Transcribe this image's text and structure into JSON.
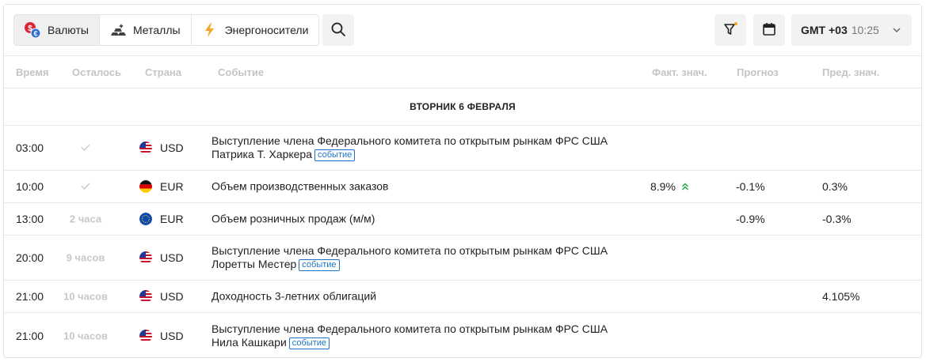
{
  "tabs": [
    {
      "label": "Валюты",
      "icon": "currency-icon",
      "active": true
    },
    {
      "label": "Металлы",
      "icon": "metal-bars-icon",
      "active": false
    },
    {
      "label": "Энергоносители",
      "icon": "lightning-icon",
      "active": false
    }
  ],
  "timezone": {
    "gmt": "GMT +03",
    "time": "10:25"
  },
  "columns": {
    "time": "Время",
    "left": "Осталось",
    "country": "Страна",
    "event": "Событие",
    "actual": "Факт. знач.",
    "forecast": "Прогноз",
    "previous": "Пред. знач."
  },
  "day_header": "ВТОРНИК 6 ФЕВРАЛЯ",
  "badge_label": "событие",
  "accent_colors": {
    "badge": "#1e73c8",
    "up_arrow": "#27a844",
    "filter_dot": "#f5a623"
  },
  "rows": [
    {
      "time": "03:00",
      "left": "",
      "done": true,
      "flag": "us",
      "currency": "USD",
      "event": "Выступление члена Федерального комитета по открытым рынкам ФРС США Патрика Т. Харкера",
      "badge": true,
      "actual": "",
      "forecast": "",
      "previous": ""
    },
    {
      "time": "10:00",
      "left": "",
      "done": true,
      "flag": "de",
      "currency": "EUR",
      "event": "Объем производственных заказов",
      "badge": false,
      "actual": "8.9%",
      "trend": "up",
      "forecast": "-0.1%",
      "previous": "0.3%"
    },
    {
      "time": "13:00",
      "left": "2 часа",
      "done": false,
      "flag": "eu",
      "currency": "EUR",
      "event": "Объем розничных продаж (м/м)",
      "badge": false,
      "actual": "",
      "forecast": "-0.9%",
      "previous": "-0.3%"
    },
    {
      "time": "20:00",
      "left": "9 часов",
      "done": false,
      "flag": "us",
      "currency": "USD",
      "event": "Выступление члена Федерального комитета по открытым рынкам ФРС США Лоретты Местер",
      "badge": true,
      "actual": "",
      "forecast": "",
      "previous": ""
    },
    {
      "time": "21:00",
      "left": "10 часов",
      "done": false,
      "flag": "us",
      "currency": "USD",
      "event": "Доходность 3-летних облигаций",
      "badge": false,
      "actual": "",
      "forecast": "",
      "previous": "4.105%"
    },
    {
      "time": "21:00",
      "left": "10 часов",
      "done": false,
      "flag": "us",
      "currency": "USD",
      "event": "Выступление члена Федерального комитета по открытым рынкам ФРС США Нила Кашкари",
      "badge": true,
      "actual": "",
      "forecast": "",
      "previous": ""
    }
  ]
}
